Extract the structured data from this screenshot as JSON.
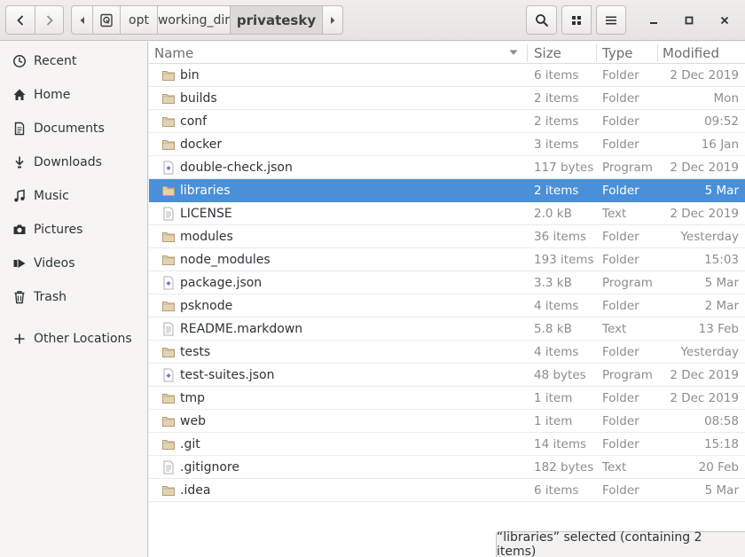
{
  "headerbar": {
    "path": [
      "opt",
      "working_dir",
      "privatesky"
    ],
    "current": "privatesky"
  },
  "sidebar": {
    "items": [
      {
        "label": "Recent",
        "icon": "clock-icon"
      },
      {
        "label": "Home",
        "icon": "home-icon"
      },
      {
        "label": "Documents",
        "icon": "document-icon"
      },
      {
        "label": "Downloads",
        "icon": "download-icon"
      },
      {
        "label": "Music",
        "icon": "music-icon"
      },
      {
        "label": "Pictures",
        "icon": "camera-icon"
      },
      {
        "label": "Videos",
        "icon": "video-icon"
      },
      {
        "label": "Trash",
        "icon": "trash-icon"
      }
    ],
    "other_locations": "Other Locations"
  },
  "columns": {
    "name": "Name",
    "size": "Size",
    "type": "Type",
    "modified": "Modified"
  },
  "files": [
    {
      "name": "bin",
      "size": "6 items",
      "type": "Folder",
      "modified": "2 Dec 2019",
      "kind": "folder"
    },
    {
      "name": "builds",
      "size": "2 items",
      "type": "Folder",
      "modified": "Mon",
      "kind": "folder"
    },
    {
      "name": "conf",
      "size": "2 items",
      "type": "Folder",
      "modified": "09:52",
      "kind": "folder"
    },
    {
      "name": "docker",
      "size": "3 items",
      "type": "Folder",
      "modified": "16 Jan",
      "kind": "folder"
    },
    {
      "name": "double-check.json",
      "size": "117 bytes",
      "type": "Program",
      "modified": "2 Dec 2019",
      "kind": "program"
    },
    {
      "name": "libraries",
      "size": "2 items",
      "type": "Folder",
      "modified": "5 Mar",
      "kind": "folder",
      "selected": true
    },
    {
      "name": "LICENSE",
      "size": "2.0 kB",
      "type": "Text",
      "modified": "2 Dec 2019",
      "kind": "text"
    },
    {
      "name": "modules",
      "size": "36 items",
      "type": "Folder",
      "modified": "Yesterday",
      "kind": "folder"
    },
    {
      "name": "node_modules",
      "size": "193 items",
      "type": "Folder",
      "modified": "15:03",
      "kind": "folder"
    },
    {
      "name": "package.json",
      "size": "3.3 kB",
      "type": "Program",
      "modified": "5 Mar",
      "kind": "program"
    },
    {
      "name": "psknode",
      "size": "4 items",
      "type": "Folder",
      "modified": "2 Mar",
      "kind": "folder"
    },
    {
      "name": "README.markdown",
      "size": "5.8 kB",
      "type": "Text",
      "modified": "13 Feb",
      "kind": "text"
    },
    {
      "name": "tests",
      "size": "4 items",
      "type": "Folder",
      "modified": "Yesterday",
      "kind": "folder"
    },
    {
      "name": "test-suites.json",
      "size": "48 bytes",
      "type": "Program",
      "modified": "2 Dec 2019",
      "kind": "program"
    },
    {
      "name": "tmp",
      "size": "1 item",
      "type": "Folder",
      "modified": "2 Dec 2019",
      "kind": "folder"
    },
    {
      "name": "web",
      "size": "1 item",
      "type": "Folder",
      "modified": "08:58",
      "kind": "folder"
    },
    {
      "name": ".git",
      "size": "14 items",
      "type": "Folder",
      "modified": "15:18",
      "kind": "folder"
    },
    {
      "name": ".gitignore",
      "size": "182 bytes",
      "type": "Text",
      "modified": "20 Feb",
      "kind": "text"
    },
    {
      "name": ".idea",
      "size": "6 items",
      "type": "Folder",
      "modified": "5 Mar",
      "kind": "folder"
    }
  ],
  "status": "“libraries” selected  (containing 2 items)",
  "colors": {
    "selection": "#4a90d9",
    "folder": "#d7c3a0"
  }
}
